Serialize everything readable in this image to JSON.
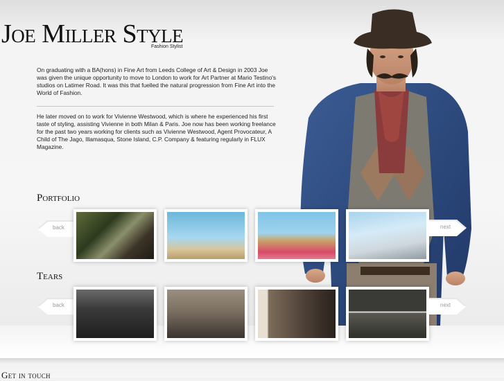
{
  "site": {
    "logo": "Joe Miller Style",
    "tagline": "Fashion Stylist"
  },
  "bio": {
    "paragraph1": "On graduating with a BA(hons) in Fine Art from Leeds College of Art & Design in 2003 Joe was given the unique opportunity to move to London to work for Art Partner at Mario Testino's studios on Latimer Road. It was this that fuelled the natural progression from Fine Art into the World of Fashion.",
    "paragraph2": "He later moved on to work for Vivienne Westwood, which is where he experienced his first taste of styling, assisting Vivienne in both Milan & Paris. Joe now has been working freelance for the past two years working for clients such as Vivienne Westwood, Agent Provocateur, A Child of The Jago, Illamasqua, Stone Island, C.P. Company & featuring regularly in FLUX Magazine."
  },
  "portfolio": {
    "title": "Portfolio",
    "back_label": "back",
    "next_label": "next",
    "thumbnails": [
      "portfolio-photo-1",
      "portfolio-photo-2",
      "portfolio-photo-3",
      "portfolio-photo-4"
    ]
  },
  "tears": {
    "title": "Tears",
    "back_label": "back",
    "next_label": "next",
    "thumbnails": [
      "tears-photo-1",
      "tears-photo-2",
      "tears-photo-3",
      "tears-photo-4"
    ]
  },
  "footer": {
    "title": "Get in touch"
  },
  "colors": {
    "background": "#f2f2f2",
    "text": "#222222",
    "arrow_label": "#9a9a9a"
  }
}
